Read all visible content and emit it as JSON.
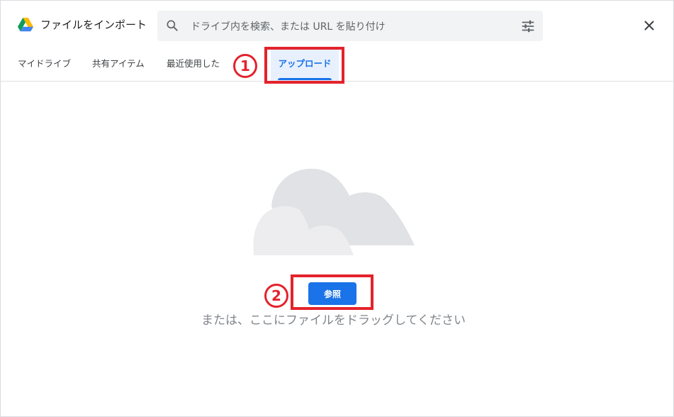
{
  "header": {
    "title": "ファイルをインポート",
    "logo_icon": "google-drive-icon",
    "search": {
      "placeholder": "ドライブ内を検索、または URL を貼り付け",
      "value": "",
      "search_icon": "search-icon",
      "options_icon": "tune-icon"
    },
    "close_icon": "close-icon"
  },
  "tabs": [
    {
      "label": "マイドライブ",
      "selected": false
    },
    {
      "label": "共有アイテム",
      "selected": false
    },
    {
      "label": "最近使用した",
      "selected": false
    },
    {
      "label": "アップロード",
      "selected": true
    }
  ],
  "upload": {
    "illustration_icon": "cloud-icon",
    "browse_label": "参照",
    "drop_text": "または、ここにファイルをドラッグしてください"
  },
  "annotations": {
    "step1": "1",
    "step2": "2",
    "color": "#e3232c"
  },
  "colors": {
    "accent": "#1a73e8",
    "selected_tab_bg": "#e8f0fe",
    "search_bg": "#f1f3f4"
  }
}
